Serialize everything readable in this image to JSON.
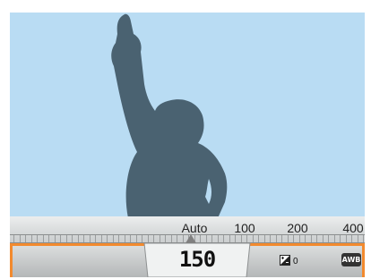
{
  "iso_scale": {
    "labels": [
      "Auto",
      "100",
      "200",
      "400"
    ]
  },
  "menu": {
    "iso_value": "150",
    "ev_value": "0",
    "wb_label": "AWB"
  },
  "icons": {
    "ev": "exposure-compensation-icon",
    "wb": "auto-white-balance-icon"
  },
  "colors": {
    "sky": "#b9dcf3",
    "silhouette": "#4a6271",
    "accent": "#f28a2e"
  }
}
